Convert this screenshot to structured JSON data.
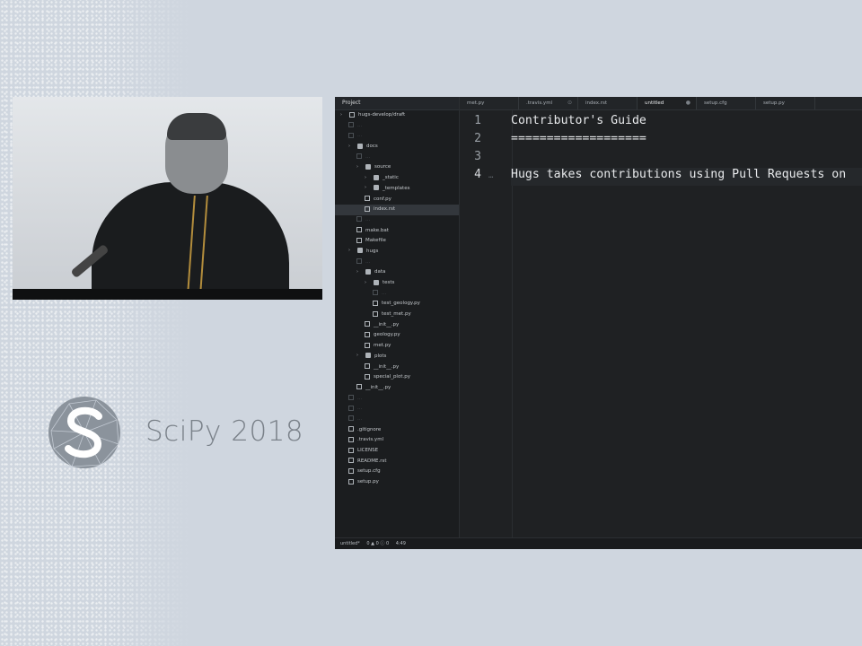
{
  "slide": {
    "brand": "SciPy 2018",
    "logo_icon": "scipy-snake-logo-icon"
  },
  "editor": {
    "tree": {
      "header": "Project",
      "items": [
        {
          "label": "hugs-develop/draft",
          "type": "root",
          "depth": 0,
          "dim": false
        },
        {
          "label": "...",
          "type": "file",
          "depth": 1,
          "dim": true
        },
        {
          "label": "...",
          "type": "file",
          "depth": 1,
          "dim": true
        },
        {
          "label": "docs",
          "type": "folder",
          "depth": 1,
          "dim": false
        },
        {
          "label": "...",
          "type": "file",
          "depth": 2,
          "dim": true
        },
        {
          "label": "source",
          "type": "folder",
          "depth": 2,
          "dim": false
        },
        {
          "label": "_static",
          "type": "folder",
          "depth": 3,
          "dim": false
        },
        {
          "label": "_templates",
          "type": "folder",
          "depth": 3,
          "dim": false
        },
        {
          "label": "conf.py",
          "type": "file",
          "depth": 3,
          "dim": false
        },
        {
          "label": "index.rst",
          "type": "file",
          "depth": 3,
          "dim": false,
          "selected": true
        },
        {
          "label": "...",
          "type": "file",
          "depth": 2,
          "dim": true
        },
        {
          "label": "make.bat",
          "type": "file",
          "depth": 2,
          "dim": false
        },
        {
          "label": "Makefile",
          "type": "file",
          "depth": 2,
          "dim": false
        },
        {
          "label": "hugs",
          "type": "folder",
          "depth": 1,
          "dim": false
        },
        {
          "label": "...",
          "type": "file",
          "depth": 2,
          "dim": true
        },
        {
          "label": "data",
          "type": "folder",
          "depth": 2,
          "dim": false
        },
        {
          "label": "tests",
          "type": "folder",
          "depth": 3,
          "dim": false
        },
        {
          "label": "...",
          "type": "file",
          "depth": 4,
          "dim": true
        },
        {
          "label": "test_geology.py",
          "type": "file",
          "depth": 4,
          "dim": false
        },
        {
          "label": "test_met.py",
          "type": "file",
          "depth": 4,
          "dim": false
        },
        {
          "label": "__init__.py",
          "type": "file",
          "depth": 3,
          "dim": false
        },
        {
          "label": "geology.py",
          "type": "file",
          "depth": 3,
          "dim": false
        },
        {
          "label": "met.py",
          "type": "file",
          "depth": 3,
          "dim": false
        },
        {
          "label": "plots",
          "type": "folder",
          "depth": 2,
          "dim": false
        },
        {
          "label": "__init__.py",
          "type": "file",
          "depth": 3,
          "dim": false
        },
        {
          "label": "special_plot.py",
          "type": "file",
          "depth": 3,
          "dim": false
        },
        {
          "label": "__init__.py",
          "type": "file",
          "depth": 2,
          "dim": false
        },
        {
          "label": "...",
          "type": "file",
          "depth": 1,
          "dim": true
        },
        {
          "label": "...",
          "type": "file",
          "depth": 1,
          "dim": true
        },
        {
          "label": "...",
          "type": "file",
          "depth": 1,
          "dim": true
        },
        {
          "label": ".gitignore",
          "type": "file",
          "depth": 1,
          "dim": false
        },
        {
          "label": ".travis.yml",
          "type": "file",
          "depth": 1,
          "dim": false
        },
        {
          "label": "LICENSE",
          "type": "file",
          "depth": 1,
          "dim": false
        },
        {
          "label": "README.rst",
          "type": "file",
          "depth": 1,
          "dim": false
        },
        {
          "label": "setup.cfg",
          "type": "file",
          "depth": 1,
          "dim": false
        },
        {
          "label": "setup.py",
          "type": "file",
          "depth": 1,
          "dim": false
        }
      ]
    },
    "tabs": [
      {
        "label": "met.py",
        "active": false
      },
      {
        "label": ".travis.yml",
        "active": false
      },
      {
        "label": "index.rst",
        "active": false
      },
      {
        "label": "untitled",
        "active": true
      },
      {
        "label": "setup.cfg",
        "active": false
      },
      {
        "label": "setup.py",
        "active": false
      }
    ],
    "lines": [
      {
        "num": "1",
        "text": "Contributor's Guide"
      },
      {
        "num": "2",
        "text": "==================="
      },
      {
        "num": "3",
        "text": ""
      },
      {
        "num": "4",
        "text": "Hugs takes contributions using Pull Requests on"
      }
    ],
    "status": {
      "file": "untitled*",
      "counts": "0 ▲ 0 ⓘ 0",
      "cursor": "4:49"
    }
  }
}
